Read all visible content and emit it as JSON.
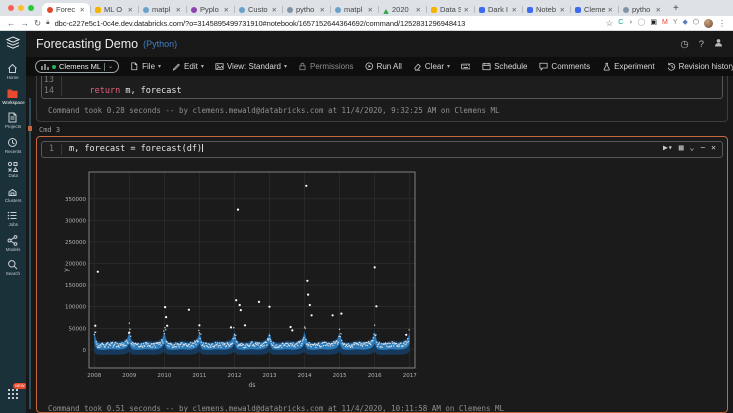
{
  "browser": {
    "tabs": [
      {
        "label": "Forec",
        "active": true,
        "favicon": "#e0492f",
        "shape": "round"
      },
      {
        "label": "ML O",
        "favicon": "#f4b400",
        "shape": "square"
      },
      {
        "label": "matpl",
        "favicon": "#6aa2c8",
        "shape": "round"
      },
      {
        "label": "Pyplo",
        "favicon": "#8e44ad",
        "shape": "round"
      },
      {
        "label": "Custo",
        "favicon": "#6aa2c8",
        "shape": "round"
      },
      {
        "label": "pytho",
        "favicon": "#7f94a8",
        "shape": "round"
      },
      {
        "label": "matpl",
        "favicon": "#6aa2c8",
        "shape": "round"
      },
      {
        "label": "2020",
        "favicon": "#34a853",
        "shape": "triangle"
      },
      {
        "label": "Data S",
        "favicon": "#f4b400",
        "shape": "square"
      },
      {
        "label": "Dark I",
        "favicon": "#3b6cf0",
        "shape": "square"
      },
      {
        "label": "Noteb",
        "favicon": "#3b6cf0",
        "shape": "square"
      },
      {
        "label": "Cleme",
        "favicon": "#3b6cf0",
        "shape": "square"
      },
      {
        "label": "pytho",
        "favicon": "#7f94a8",
        "shape": "round"
      }
    ],
    "new_tab": "+",
    "back": "←",
    "forward": "→",
    "reload": "↻",
    "star": "☆",
    "menu": "⋮",
    "url": "dbc-c227e5c1-0c4e.dev.databricks.com/?o=3145895499731910#notebook/1657152644364692/command/1252831296948413",
    "extensions": [
      {
        "glyph": "C",
        "color": "#13a08d"
      },
      {
        "glyph": "◑",
        "color": "#9aa0a6"
      },
      {
        "glyph": "◯",
        "color": "#9aa0a6"
      },
      {
        "glyph": "▣",
        "color": "#202124"
      },
      {
        "glyph": "M",
        "color": "#ea4335"
      },
      {
        "glyph": "Y",
        "color": "#80868b"
      },
      {
        "glyph": "◆",
        "color": "#5b7fb9"
      },
      {
        "glyph": "⬡",
        "color": "#555"
      }
    ]
  },
  "sidebar": {
    "items": [
      {
        "label": "Home",
        "icon": "home"
      },
      {
        "label": "Workspace",
        "icon": "workspace",
        "active": true
      },
      {
        "label": "Projects",
        "icon": "projects"
      },
      {
        "label": "Recents",
        "icon": "recents"
      },
      {
        "label": "Data",
        "icon": "data"
      },
      {
        "label": "Clusters",
        "icon": "clusters"
      },
      {
        "label": "Jobs",
        "icon": "jobs"
      },
      {
        "label": "Models",
        "icon": "models"
      },
      {
        "label": "Search",
        "icon": "search"
      }
    ],
    "new_badge": "NEW"
  },
  "header": {
    "title": "Forecasting Demo",
    "language": "(Python)",
    "right_icons": [
      {
        "name": "status-clock-icon",
        "glyph": "◷"
      },
      {
        "name": "help-icon",
        "glyph": "?"
      },
      {
        "name": "account-icon",
        "glyph": "person"
      }
    ]
  },
  "toolbar": {
    "cluster_label": "Clemens ML",
    "menus_left": [
      {
        "name": "file-menu",
        "label": "File",
        "icon": "file",
        "caret": true
      },
      {
        "name": "edit-menu",
        "label": "Edit",
        "icon": "pencil",
        "caret": true
      },
      {
        "name": "view-menu",
        "label": "View: Standard",
        "icon": "image",
        "caret": true
      },
      {
        "name": "permissions-button",
        "label": "Permissions",
        "icon": "lock",
        "dim": true
      },
      {
        "name": "run-all-button",
        "label": "Run All",
        "icon": "run"
      },
      {
        "name": "clear-menu",
        "label": "Clear",
        "icon": "eraser",
        "caret": true
      }
    ],
    "menus_right": [
      {
        "name": "shortcuts-button",
        "label": "",
        "icon": "keyboard"
      },
      {
        "name": "schedule-button",
        "label": "Schedule",
        "icon": "calendar"
      },
      {
        "name": "comments-button",
        "label": "Comments",
        "icon": "comment"
      },
      {
        "name": "experiment-button",
        "label": "Experiment",
        "icon": "flask"
      },
      {
        "name": "revision-history-button",
        "label": "Revision history",
        "icon": "history"
      }
    ]
  },
  "notebook": {
    "cell_prev": {
      "line1_no": "13",
      "line1_code": "",
      "line2_no": "14",
      "line2_indent": "    ",
      "line2_keyword": "return",
      "line2_rest": " m, forecast",
      "status": "Command took 0.28 seconds -- by clemens.mewald@databricks.com at 11/4/2020, 9:32:25 AM on Clemens ML"
    },
    "cmd_label": "Cmd 3",
    "cell": {
      "line_no": "1",
      "code": "m, forecast = forecast(df)",
      "icons": [
        {
          "name": "run-cell-button",
          "glyph": "▶▾"
        },
        {
          "name": "dashboard-chart-icon",
          "glyph": "▦"
        },
        {
          "name": "collapse-cell-icon",
          "glyph": "⌄"
        },
        {
          "name": "minimize-cell-icon",
          "glyph": "−"
        },
        {
          "name": "delete-cell-icon",
          "glyph": "✕"
        }
      ],
      "status": "Command took 0.51 seconds -- by clemens.mewald@databricks.com at 11/4/2020, 10:11:58 AM on Clemens ML"
    }
  },
  "chart_data": {
    "type": "scatter",
    "title": "",
    "xlabel": "ds",
    "ylabel": "y",
    "xlim": [
      2007.85,
      2017.15
    ],
    "ylim": [
      -42000,
      412000
    ],
    "x_ticks": [
      2008,
      2009,
      2010,
      2011,
      2012,
      2013,
      2014,
      2015,
      2016,
      2017
    ],
    "y_ticks": [
      0,
      50000,
      100000,
      150000,
      200000,
      250000,
      300000,
      350000
    ],
    "grid": true,
    "legend": false,
    "colors": {
      "band_outer": "#15416b",
      "band_inner": "#2e7fc2",
      "points": "#e9e9e9",
      "frame": "#9a9a9a",
      "gridline": "#323232",
      "tick_text": "#b3b3b3"
    },
    "series": [
      {
        "name": "forecast uncertainty band (Prophet yhat interval)",
        "type": "band",
        "years_start": 2008.0,
        "years_end": 2017.0,
        "profile_t": [
          0.0,
          0.03,
          0.08,
          0.17,
          0.25,
          0.33,
          0.42,
          0.5,
          0.58,
          0.67,
          0.75,
          0.83,
          0.92,
          0.97
        ],
        "profile_center": [
          30000,
          20000,
          11000,
          9000,
          8500,
          9000,
          10000,
          11000,
          10500,
          9500,
          10000,
          11500,
          15000,
          22000
        ],
        "profile_half_width": [
          17000,
          14000,
          11000,
          10000,
          10000,
          10000,
          10500,
          11000,
          11000,
          10500,
          10500,
          11000,
          12000,
          14000
        ]
      },
      {
        "name": "observed values (dense weekly points along forecast center)",
        "type": "scatter-dense",
        "points_per_year": 52
      },
      {
        "name": "observed outliers",
        "type": "scatter",
        "points": [
          [
            2008.03,
            56000
          ],
          [
            2008.1,
            181000
          ],
          [
            2009.0,
            40000
          ],
          [
            2010.02,
            99000
          ],
          [
            2010.05,
            76000
          ],
          [
            2010.08,
            56000
          ],
          [
            2010.7,
            93000
          ],
          [
            2011.0,
            57000
          ],
          [
            2011.9,
            52000
          ],
          [
            2012.05,
            115000
          ],
          [
            2012.1,
            325000
          ],
          [
            2012.15,
            104000
          ],
          [
            2012.18,
            92000
          ],
          [
            2012.3,
            57000
          ],
          [
            2012.7,
            111000
          ],
          [
            2013.0,
            100000
          ],
          [
            2013.6,
            53000
          ],
          [
            2013.65,
            45000
          ],
          [
            2014.05,
            380000
          ],
          [
            2014.08,
            160000
          ],
          [
            2014.1,
            128000
          ],
          [
            2014.15,
            104000
          ],
          [
            2014.2,
            80000
          ],
          [
            2014.8,
            80000
          ],
          [
            2015.05,
            84000
          ],
          [
            2016.0,
            191000
          ],
          [
            2016.05,
            101000
          ],
          [
            2016.9,
            35000
          ]
        ]
      }
    ]
  }
}
